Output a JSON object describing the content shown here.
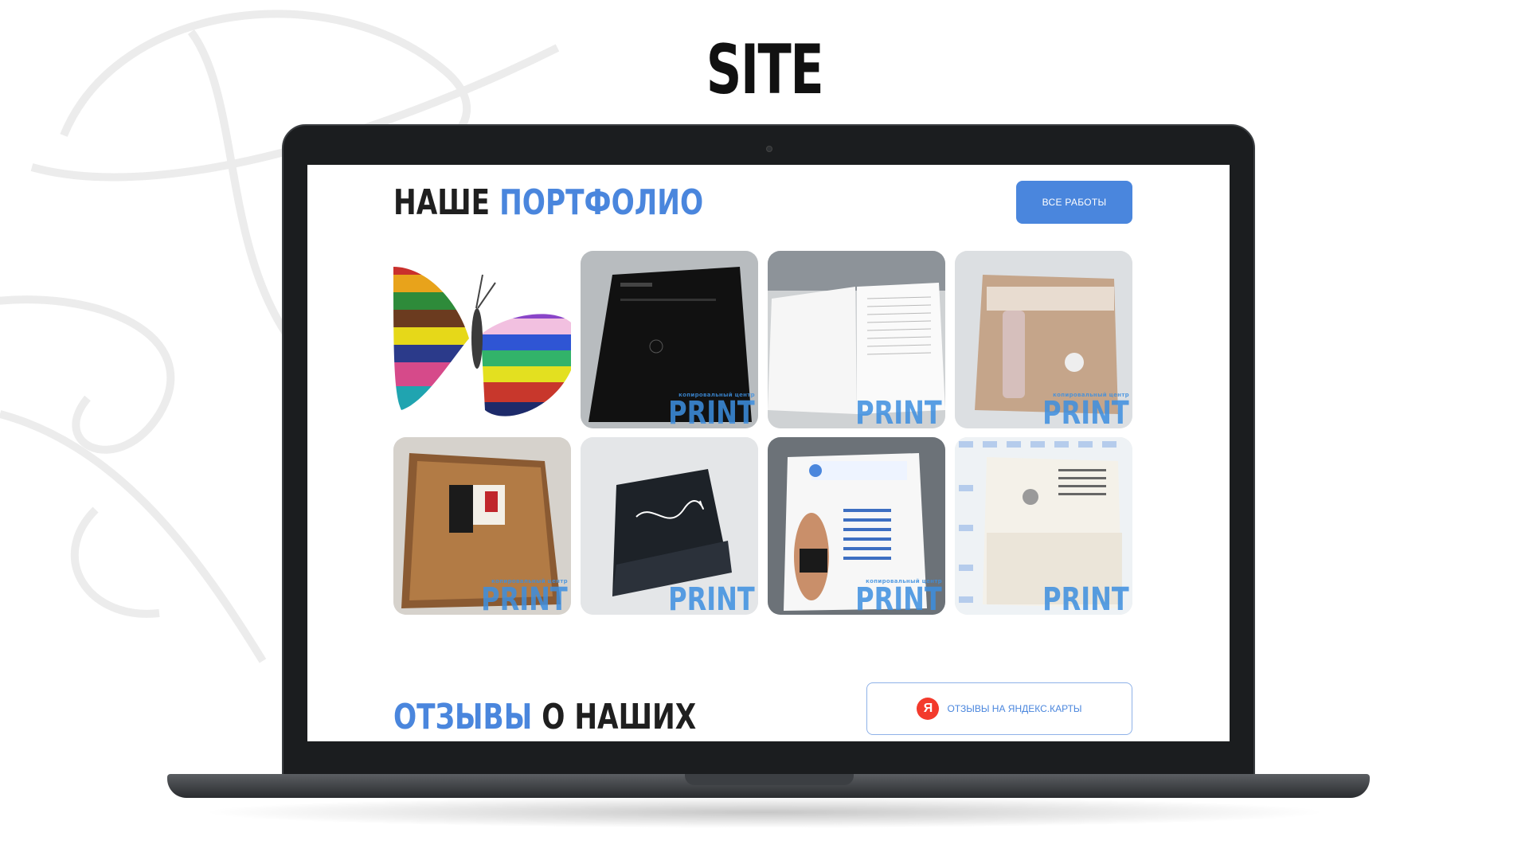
{
  "page": {
    "heading": "SITE"
  },
  "portfolio": {
    "title_part1": "НАШЕ",
    "title_part2": "ПОРТФОЛИО",
    "all_works_label": "Все работы",
    "items": [
      {
        "alt": "butterfly"
      },
      {
        "alt": "black document"
      },
      {
        "alt": "open book"
      },
      {
        "alt": "brochure"
      },
      {
        "alt": "company folder"
      },
      {
        "alt": "calligraphy print"
      },
      {
        "alt": "onefit flyer"
      },
      {
        "alt": "document with pattern"
      }
    ],
    "watermark_small": "копировальный центр",
    "watermark_big": "PRINT"
  },
  "reviews": {
    "title_part1": "ОТЗЫВЫ",
    "title_part2": "О НАШИХ",
    "yandex_label": "Отзывы на Яндекс.Карты",
    "yandex_icon_letter": "Я"
  },
  "colors": {
    "accent": "#4a86dd",
    "yandex": "#f33a2c"
  }
}
